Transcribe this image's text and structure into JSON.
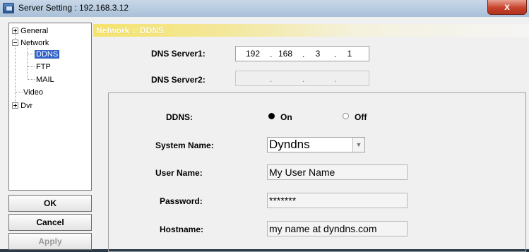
{
  "window": {
    "title": "Server Setting : 192.168.3.12",
    "close_label": "x"
  },
  "tree": {
    "general": "General",
    "network": "Network",
    "ddns": "DDNS",
    "ftp": "FTP",
    "mail": "MAIL",
    "video": "Video",
    "dvr": "Dvr"
  },
  "buttons": {
    "ok": "OK",
    "cancel": "Cancel",
    "apply": "Apply"
  },
  "section": {
    "title": "Network :: DDNS"
  },
  "dns": {
    "server1_label": "DNS Server1:",
    "server1_octets": [
      "192",
      "168",
      "3",
      "1"
    ],
    "server2_label": "DNS Server2:",
    "server2_octets": [
      "",
      "",
      "",
      ""
    ]
  },
  "ddns": {
    "label": "DDNS:",
    "on_label": "On",
    "off_label": "Off",
    "selected": "On",
    "system_name_label": "System Name:",
    "system_name_value": "Dyndns",
    "user_name_label": "User Name:",
    "user_name_value": "My User Name",
    "password_label": "Password:",
    "password_value": "*******",
    "hostname_label": "Hostname:",
    "hostname_value": "my name at dyndns.com"
  }
}
